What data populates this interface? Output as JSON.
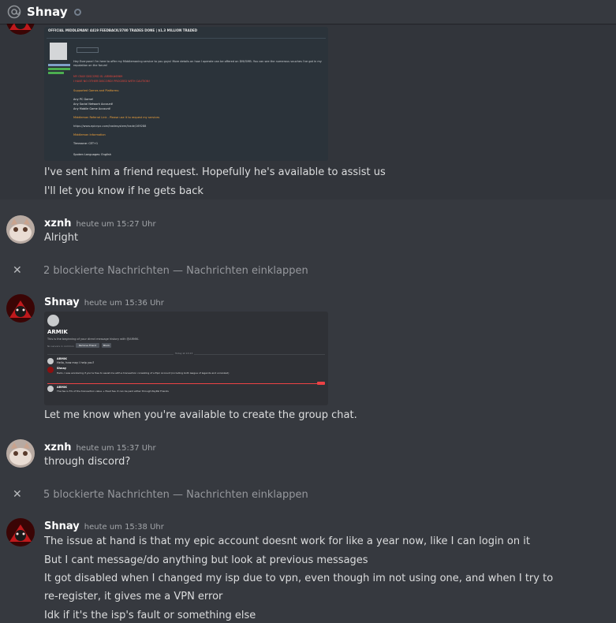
{
  "header": {
    "title": "Shnay",
    "at_icon": "at-icon",
    "status": "offline"
  },
  "messages": {
    "m1": {
      "image": {
        "heading": "OFFICIAL MIDDLEMAN! 4419 FEEDBACK/3780 TRADES DONE | $1.3 MILLION TRADED",
        "line1": "Hey Everyone! I'm here to offer my Middlemaning service to you guys! More details on how I operate can be offered on DM/OMB. You can see the numerous vouches I've got in my reputation on the forum!",
        "lines": [
          "MY ONLY DISCORD IS: ARMIK#6969",
          "I HAVE NO OTHER DISCORD! PROCEED WITH CAUTION!",
          "Supported Games and Platforms:",
          "Any PC Game!",
          "Any Social Network Account!",
          "Any Mobile Game Account!",
          "Middleman Referral Link - Please use it to request my services",
          "https://www.epicnpc.com/tradesystem/trade/169288",
          "Middleman Information",
          "Timezone: CET+1",
          "Spoken Languages: English"
        ]
      },
      "lines": [
        "I've sent him a friend request. Hopefully he's available to assist us",
        "I'll let you know if he gets back"
      ]
    },
    "m2": {
      "author": "xznh",
      "time": "heute um 15:27 Uhr",
      "lines": [
        "Alright"
      ]
    },
    "b1": "2 blockierte Nachrichten — Nachrichten einklappen",
    "m3": {
      "author": "Shnay",
      "time": "heute um 15:36 Uhr",
      "image": {
        "name": "ARMIK",
        "intro": "This is the beginning of your direct message history with @ARMIK.",
        "mutual": "No servers in common",
        "btn1": "Remove Friend",
        "btn2": "Block",
        "date": "Today at 13:23",
        "c1_name": "ARMIK",
        "c1_text": "Hello, how may I help you?",
        "c2_name": "Shnay",
        "c2_text": "Hello, I was wondering if you're free to assist me with a transaction consisting of a Epic Account (including both league of legends and unranked)",
        "c3_name": "ARMIK",
        "c3_text": "The fee is 5% of the transaction value + fixed fee. It can be paid either through PayPal Friends"
      },
      "lines": [
        "Let me know when you're available to create the group chat."
      ]
    },
    "m4": {
      "author": "xznh",
      "time": "heute um 15:37 Uhr",
      "lines": [
        "through discord?"
      ]
    },
    "b2": "5 blockierte Nachrichten — Nachrichten einklappen",
    "m5": {
      "author": "Shnay",
      "time": "heute um 15:38 Uhr",
      "lines": [
        "The issue at hand is that my epic account doesnt work for like a year now, like I can login on it",
        "But I cant message/do anything but look at previous messages",
        "It got disabled when I changed my isp due to vpn, even though im not using one, and when I try to",
        "re-register, it gives me a VPN error",
        "Idk if it's the isp's fault or something else"
      ]
    }
  },
  "colors": {
    "bg": "#36393f",
    "hover": "#32353b",
    "author": "#ffffff",
    "muted": "#a3a6aa",
    "text": "#dcddde"
  }
}
